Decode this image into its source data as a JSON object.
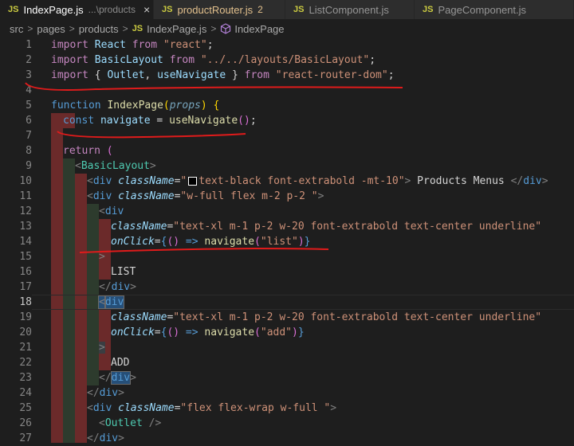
{
  "tabs": [
    {
      "icon": "JS",
      "name": "IndexPage.js",
      "desc": "...\\products",
      "close": "×"
    },
    {
      "icon": "JS",
      "name": "productRouter.js",
      "badge": "2"
    },
    {
      "icon": "JS",
      "name": "ListComponent.js"
    },
    {
      "icon": "JS",
      "name": "PageComponent.js"
    }
  ],
  "breadcrumb": {
    "parts": [
      "src",
      "pages",
      "products"
    ],
    "separator": ">",
    "file_icon": "JS",
    "file": "IndexPage.js",
    "symbol_icon": "cube-icon",
    "symbol": "IndexPage"
  },
  "editor": {
    "current_line": 18,
    "line_numbers": [
      "1",
      "2",
      "3",
      "4",
      "5",
      "6",
      "7",
      "8",
      "9",
      "10",
      "11",
      "12",
      "13",
      "14",
      "15",
      "16",
      "17",
      "18",
      "19",
      "20",
      "21",
      "22",
      "23",
      "24",
      "25",
      "26",
      "27"
    ],
    "lines": {
      "l1": [
        "import",
        " React ",
        "from",
        " \"react\"",
        ";"
      ],
      "l2": [
        "import",
        " BasicLayout ",
        "from",
        " \"../../layouts/BasicLayout\"",
        ";"
      ],
      "l3": [
        "import",
        " { ",
        "Outlet",
        ", ",
        "useNavigate",
        " } ",
        "from",
        " \"react-router-dom\"",
        ";"
      ],
      "l5": [
        "function",
        " ",
        "IndexPage",
        "(",
        "props",
        ") {"
      ],
      "l6": [
        "const",
        " ",
        "navigate",
        " = ",
        "useNavigate",
        "()",
        ";"
      ],
      "l8": [
        "return",
        " ("
      ],
      "l9": [
        "<",
        "BasicLayout",
        ">"
      ],
      "l10": [
        "<",
        "div",
        " ",
        "className",
        "=",
        "\"",
        "text-black font-extrabold -mt-10\"",
        ">",
        " Products Menus ",
        "</",
        "div",
        ">"
      ],
      "l11": [
        "<",
        "div",
        " ",
        "className",
        "=",
        "\"w-full flex m-2 p-2 \"",
        ">"
      ],
      "l12": [
        "<",
        "div"
      ],
      "l13": [
        "className",
        "=",
        "\"text-xl m-1 p-2 w-20 font-extrabold text-center underline\""
      ],
      "l14": [
        "onClick",
        "=",
        "{",
        "()",
        " => ",
        "navigate",
        "(",
        "\"list\"",
        ")",
        "}"
      ],
      "l15": [
        ">"
      ],
      "l16": [
        "LIST"
      ],
      "l17": [
        "</",
        "div",
        ">"
      ],
      "l18": [
        "<",
        "div"
      ],
      "l19": [
        "className",
        "=",
        "\"text-xl m-1 p-2 w-20 font-extrabold text-center underline\""
      ],
      "l20": [
        "onClick",
        "=",
        "{",
        "()",
        " => ",
        "navigate",
        "(",
        "\"add\"",
        ")",
        "}"
      ],
      "l21": [
        ">"
      ],
      "l22": [
        "ADD"
      ],
      "l23": [
        "</",
        "div",
        ">"
      ],
      "l24": [
        "</",
        "div",
        ">"
      ],
      "l25": [
        "<",
        "div",
        " ",
        "className",
        "=",
        "\"flex flex-wrap w-full \"",
        ">"
      ],
      "l26": [
        "<",
        "Outlet",
        " />"
      ],
      "l27": [
        "</",
        "div",
        ">"
      ]
    }
  },
  "colors": {
    "background": "#1e1e1e",
    "annotation_underline": "#e01b1b",
    "indent_guide_error": "#6b2a2a",
    "indent_guide_ok": "#2d3b2d"
  }
}
